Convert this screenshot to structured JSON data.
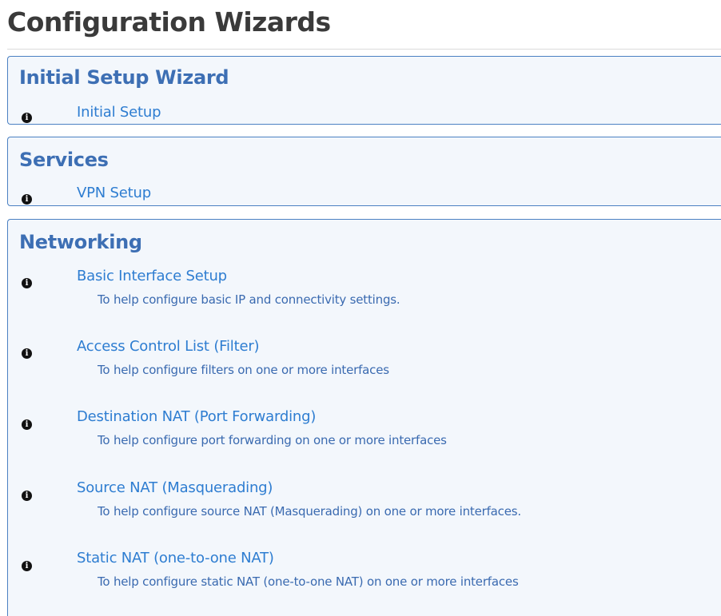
{
  "page": {
    "title": "Configuration Wizards"
  },
  "sections": [
    {
      "heading": "Initial Setup Wizard",
      "items": [
        {
          "label": "Initial Setup",
          "icon": "info-icon"
        }
      ]
    },
    {
      "heading": "Services",
      "items": [
        {
          "label": "VPN Setup",
          "icon": "info-icon"
        }
      ]
    },
    {
      "heading": "Networking",
      "items": [
        {
          "label": "Basic Interface Setup",
          "description": "To help configure basic IP and connectivity settings.",
          "icon": "info-icon"
        },
        {
          "label": "Access Control List (Filter)",
          "description": "To help configure filters on one or more interfaces",
          "icon": "info-icon"
        },
        {
          "label": "Destination NAT (Port Forwarding)",
          "description": "To help configure port forwarding on one or more interfaces",
          "icon": "info-icon"
        },
        {
          "label": "Source NAT (Masquerading)",
          "description": "To help configure source NAT (Masquerading) on one or more interfaces.",
          "icon": "info-icon"
        },
        {
          "label": "Static NAT (one-to-one NAT)",
          "description": "To help configure static NAT (one-to-one NAT) on one or more interfaces",
          "icon": "info-icon"
        }
      ]
    }
  ],
  "colors": {
    "heading": "#3d6fb4",
    "link": "#2e7dd1",
    "border": "#4b80c2",
    "panel_bg": "#f3f7fc"
  }
}
